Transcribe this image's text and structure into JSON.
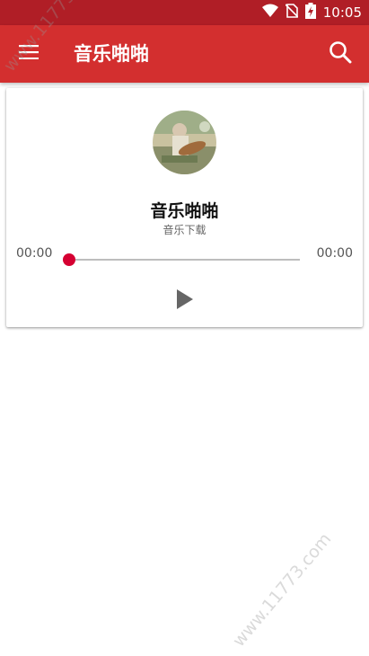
{
  "status_bar": {
    "time": "10:05",
    "icons": [
      "wifi-icon",
      "no-sim-icon",
      "battery-charging-icon"
    ]
  },
  "toolbar": {
    "title": "音乐啪啪",
    "menu_icon": "hamburger-menu-icon",
    "search_icon": "search-icon"
  },
  "player": {
    "album_art": "album-art-image",
    "song_title": "音乐啪啪",
    "song_subtitle": "音乐下载",
    "current_time": "00:00",
    "total_time": "00:00",
    "progress": 0,
    "play_icon": "play-icon"
  },
  "watermark": {
    "text": "www.11773.com"
  },
  "colors": {
    "toolbar": "#d32f2f",
    "status_bar": "#b01e26",
    "seek_thumb": "#d50032"
  }
}
